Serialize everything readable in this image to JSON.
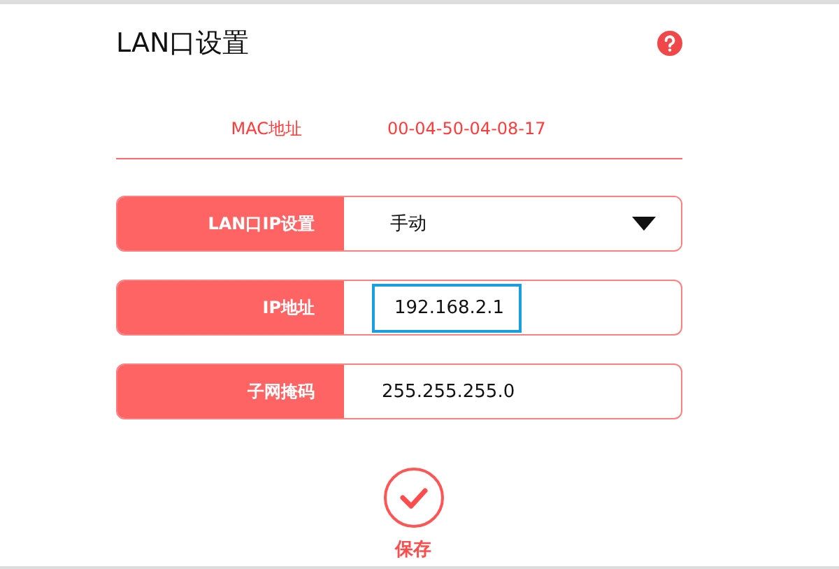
{
  "title": "LAN口设置",
  "mac": {
    "label": "MAC地址",
    "value": "00-04-50-04-08-17"
  },
  "fields": [
    {
      "kind": "select",
      "label": "LAN口IP设置",
      "value": "手动",
      "highlighted": false
    },
    {
      "kind": "input",
      "label": "IP地址",
      "value": "192.168.2.1",
      "highlighted": true
    },
    {
      "kind": "input",
      "label": "子网掩码",
      "value": "255.255.255.0",
      "highlighted": false
    }
  ],
  "save": {
    "label": "保存"
  }
}
